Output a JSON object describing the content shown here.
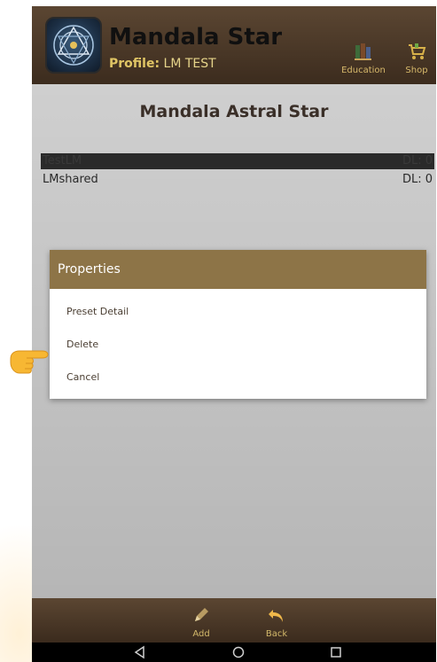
{
  "header": {
    "app_title": "Mandala Star",
    "profile_label": "Profile:",
    "profile_value": "LM TEST",
    "education_label": "Education",
    "shop_label": "Shop"
  },
  "content": {
    "title": "Mandala Astral Star",
    "presets": [
      {
        "name": "TestLM",
        "dl": "DL: 0",
        "selected": true
      },
      {
        "name": "LMshared",
        "dl": "DL: 0",
        "selected": false
      }
    ]
  },
  "dialog": {
    "title": "Properties",
    "options": [
      "Preset Detail",
      "Delete",
      "Cancel"
    ]
  },
  "bottom_bar": {
    "add_label": "Add",
    "back_label": "Back"
  },
  "colors": {
    "header_brown": "#4a3826",
    "dialog_header": "#8d7447",
    "accent_gold": "#e0c565"
  },
  "icons": {
    "education": "books-icon",
    "shop": "shopping-cart-icon",
    "add": "pencil-icon",
    "back": "back-arrow-icon",
    "pointer": "pointing-hand-icon"
  }
}
